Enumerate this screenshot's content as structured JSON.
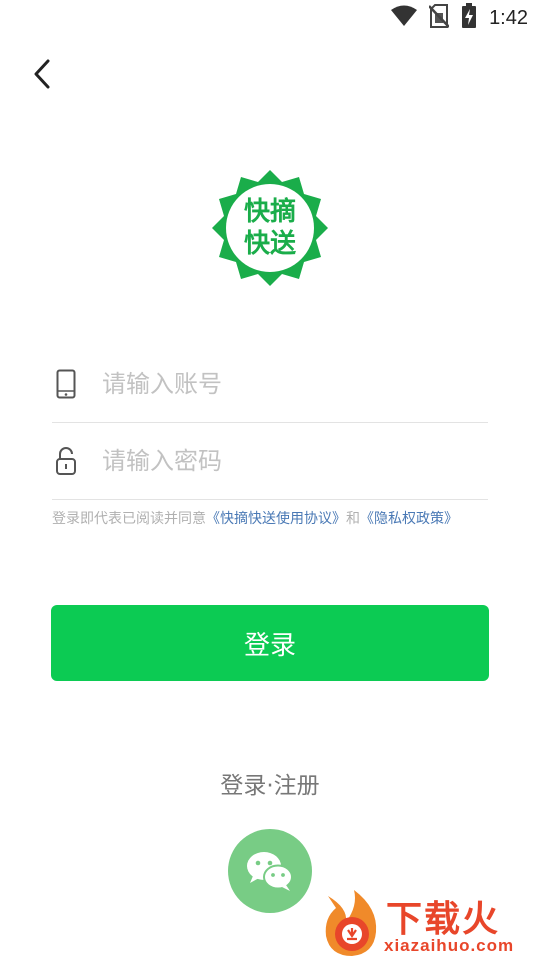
{
  "status_bar": {
    "time": "1:42",
    "icons": [
      "wifi-icon",
      "no-sim-icon",
      "battery-charging-icon"
    ]
  },
  "nav": {
    "back_icon": "chevron-left-icon"
  },
  "logo": {
    "line1": "快摘",
    "line2": "快送",
    "color": "#1aad4a"
  },
  "form": {
    "account": {
      "placeholder": "请输入账号",
      "value": "",
      "icon": "phone-icon"
    },
    "password": {
      "placeholder": "请输入密码",
      "value": "",
      "icon": "unlock-icon"
    }
  },
  "agreement": {
    "prefix": "登录即代表已阅读并同意",
    "terms_link": "《快摘快送使用协议》",
    "joiner": "和",
    "privacy_link": "《隐私权政策》"
  },
  "login_button": {
    "label": "登录",
    "color": "#0ccb53"
  },
  "register": {
    "label": "登录·注册"
  },
  "wechat": {
    "icon": "wechat-icon",
    "color": "#78cc85"
  },
  "watermark": {
    "title": "下载火",
    "subtitle": "xiazaihuo.com",
    "color": "#e8462a"
  }
}
